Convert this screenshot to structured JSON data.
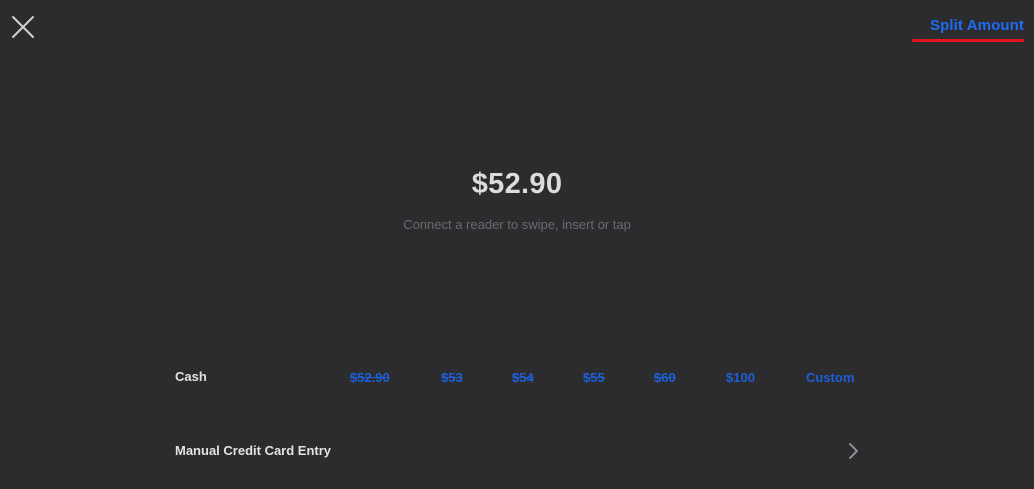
{
  "header": {
    "close_icon": "close-icon",
    "split_label": "Split Amount",
    "accent_color": "#1f6cf3",
    "underline_color": "#e5121f"
  },
  "payment": {
    "amount": "$52.90",
    "hint": "Connect a reader to swipe, insert or tap"
  },
  "cash": {
    "label": "Cash",
    "options": [
      "$52.90",
      "$53",
      "$54",
      "$55",
      "$60",
      "$100",
      "Custom"
    ]
  },
  "manual": {
    "label": "Manual Credit Card Entry",
    "chevron_icon": "chevron-right-icon"
  }
}
